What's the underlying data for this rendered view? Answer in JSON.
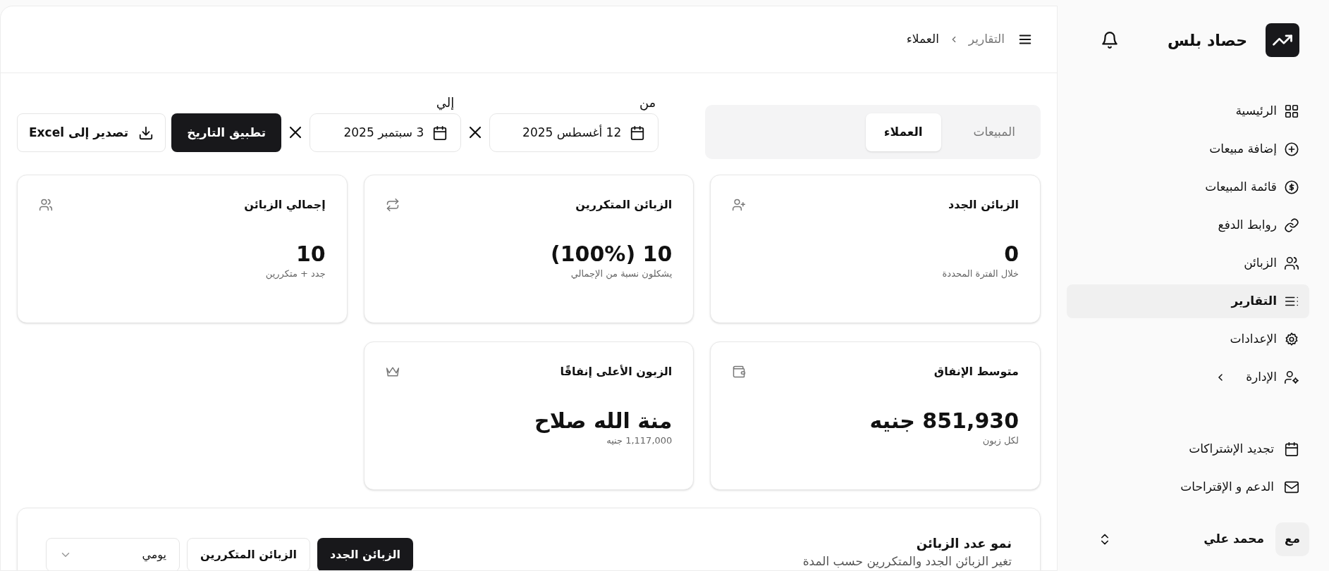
{
  "brand": {
    "name": "حصاد بلس"
  },
  "nav": [
    {
      "label": "الرئيسية",
      "selected": false,
      "kind": "link"
    },
    {
      "label": "إضافة مبيعات",
      "selected": false,
      "kind": "link"
    },
    {
      "label": "قائمة المبيعات",
      "selected": false,
      "kind": "link"
    },
    {
      "label": "روابط الدفع",
      "selected": false,
      "kind": "link"
    },
    {
      "label": "الزبائن",
      "selected": false,
      "kind": "link"
    },
    {
      "label": "التقارير",
      "selected": true,
      "kind": "link"
    },
    {
      "label": "الإعدادات",
      "selected": false,
      "kind": "link"
    },
    {
      "label": "الإدارة",
      "selected": false,
      "kind": "group"
    }
  ],
  "secondary_nav": [
    {
      "label": "تجديد الإشتراكات"
    },
    {
      "label": "الدعم و الإقتراحات"
    }
  ],
  "user": {
    "initials": "مع",
    "name": "محمد علي"
  },
  "breadcrumb": [
    "التقارير",
    "العملاء"
  ],
  "tabs": [
    {
      "label": "المبيعات",
      "selected": false
    },
    {
      "label": "العملاء",
      "selected": true
    }
  ],
  "date_from": {
    "label": "من",
    "value": "12 أغسطس 2025"
  },
  "date_to": {
    "label": "إلي",
    "value": "3 سبتمبر 2025"
  },
  "apply_button": "تطبيق التاريخ",
  "export_button": "تصدير إلى Excel",
  "stats": [
    {
      "title": "الزبائن الجدد",
      "value": "0",
      "caption": "خلال الفترة المحددة"
    },
    {
      "title": "الزبائن المتكررين",
      "value": "10 (100%)",
      "caption": "يشكلون نسبة من الإجمالي"
    },
    {
      "title": "إجمالي الزبائن",
      "value": "10",
      "caption": "جدد + متكررين"
    },
    {
      "title": "متوسط الإنفاق",
      "value": "851,930 جنيه",
      "caption": "لكل زبون"
    },
    {
      "title": "الزبون الأعلى إنفاقًا",
      "value": "منة الله صلاح",
      "caption": "1,117,000 جنيه"
    }
  ],
  "growth_chart": {
    "title": "نمو عدد الزبائن",
    "subtitle": "تغير الزبائن الجدد والمتكررين حسب المدة",
    "series_buttons": [
      {
        "label": "الزبائن الجدد",
        "selected": true
      },
      {
        "label": "الزبائن المتكررين",
        "selected": false
      }
    ],
    "period": "يومي"
  }
}
